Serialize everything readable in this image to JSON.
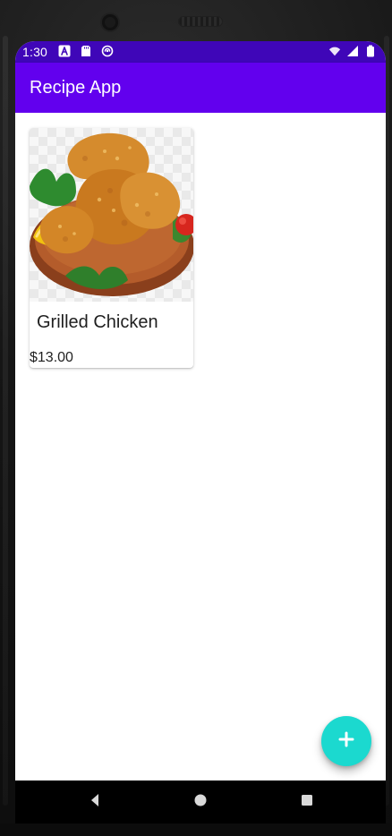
{
  "status_bar": {
    "time": "1:30",
    "bg_color": "#3f06b8"
  },
  "app_bar": {
    "title": "Recipe App",
    "bg_color": "#6200ee"
  },
  "recipes": [
    {
      "name": "Grilled Chicken",
      "price": "$13.00",
      "image_icon": "fried-chicken-photo"
    }
  ],
  "fab": {
    "icon": "plus-icon",
    "color": "#1bd9cf"
  },
  "nav_bar": {
    "back_icon": "back-icon",
    "home_icon": "home-icon",
    "recent_icon": "recent-apps-icon"
  }
}
